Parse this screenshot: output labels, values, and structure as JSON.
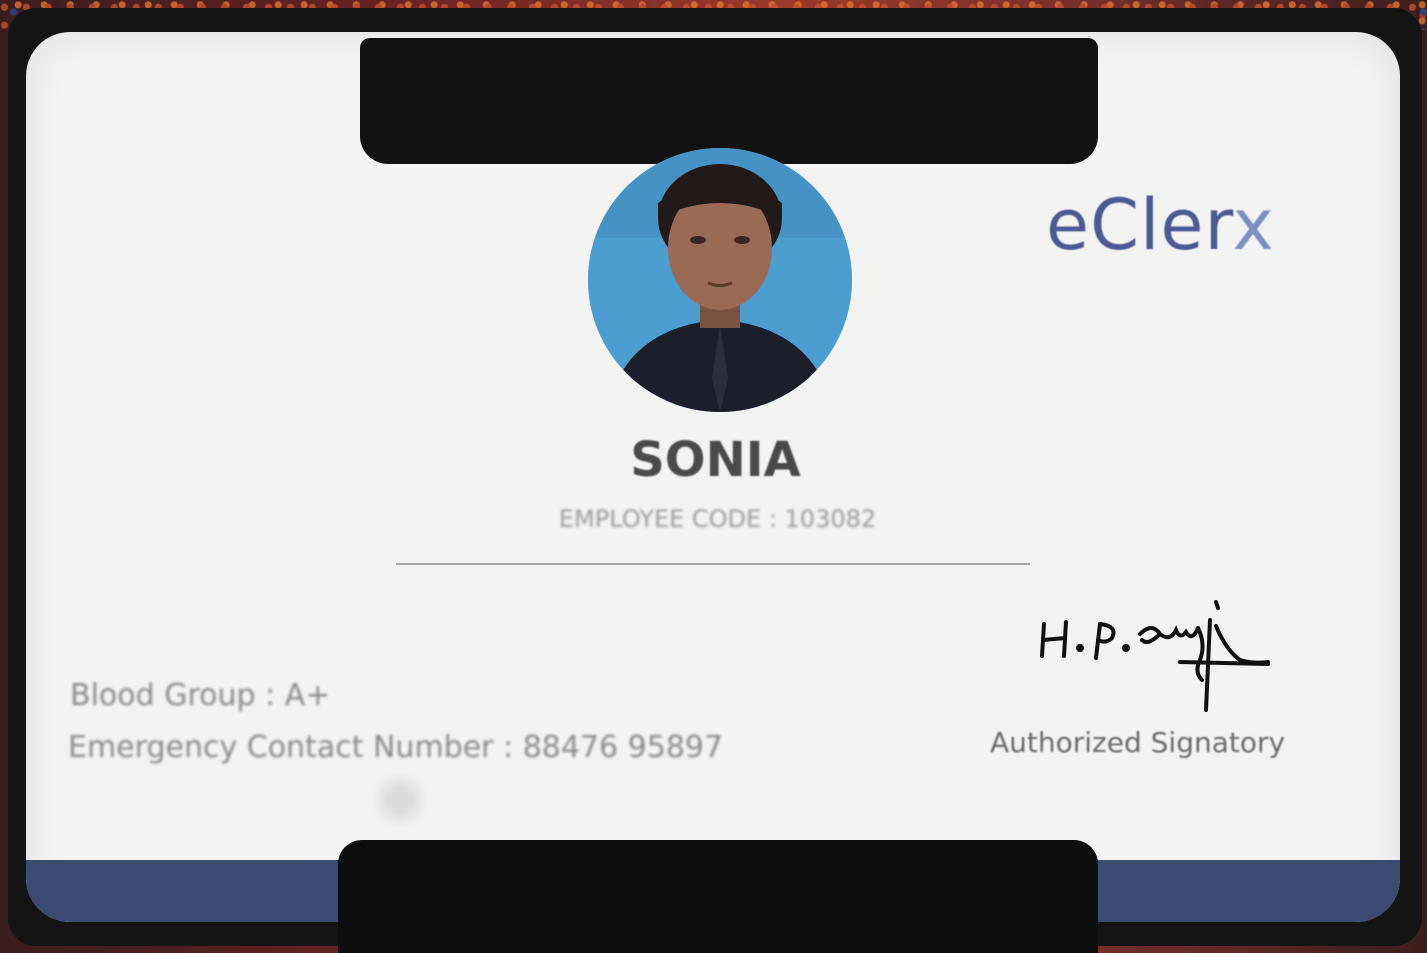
{
  "card": {
    "logo_main": "eCler",
    "logo_x": "x",
    "name": "SONIA",
    "employee_code": "EMPLOYEE CODE : 103082",
    "blood_group": "Blood Group : A+",
    "emergency_contact": "Emergency Contact Number : 88476 95897",
    "signatory_label": "Authorized Signatory",
    "signature_text": "H. P. Gungi"
  },
  "colors": {
    "logo": "#4c5a93",
    "card_background": "#f3f3f2",
    "holder": "#141414",
    "photo_background": "#4a9bcf",
    "bottom_band": "#3a4a70"
  },
  "icons": {
    "photo": "person-portrait",
    "signature": "handwritten-signature"
  }
}
